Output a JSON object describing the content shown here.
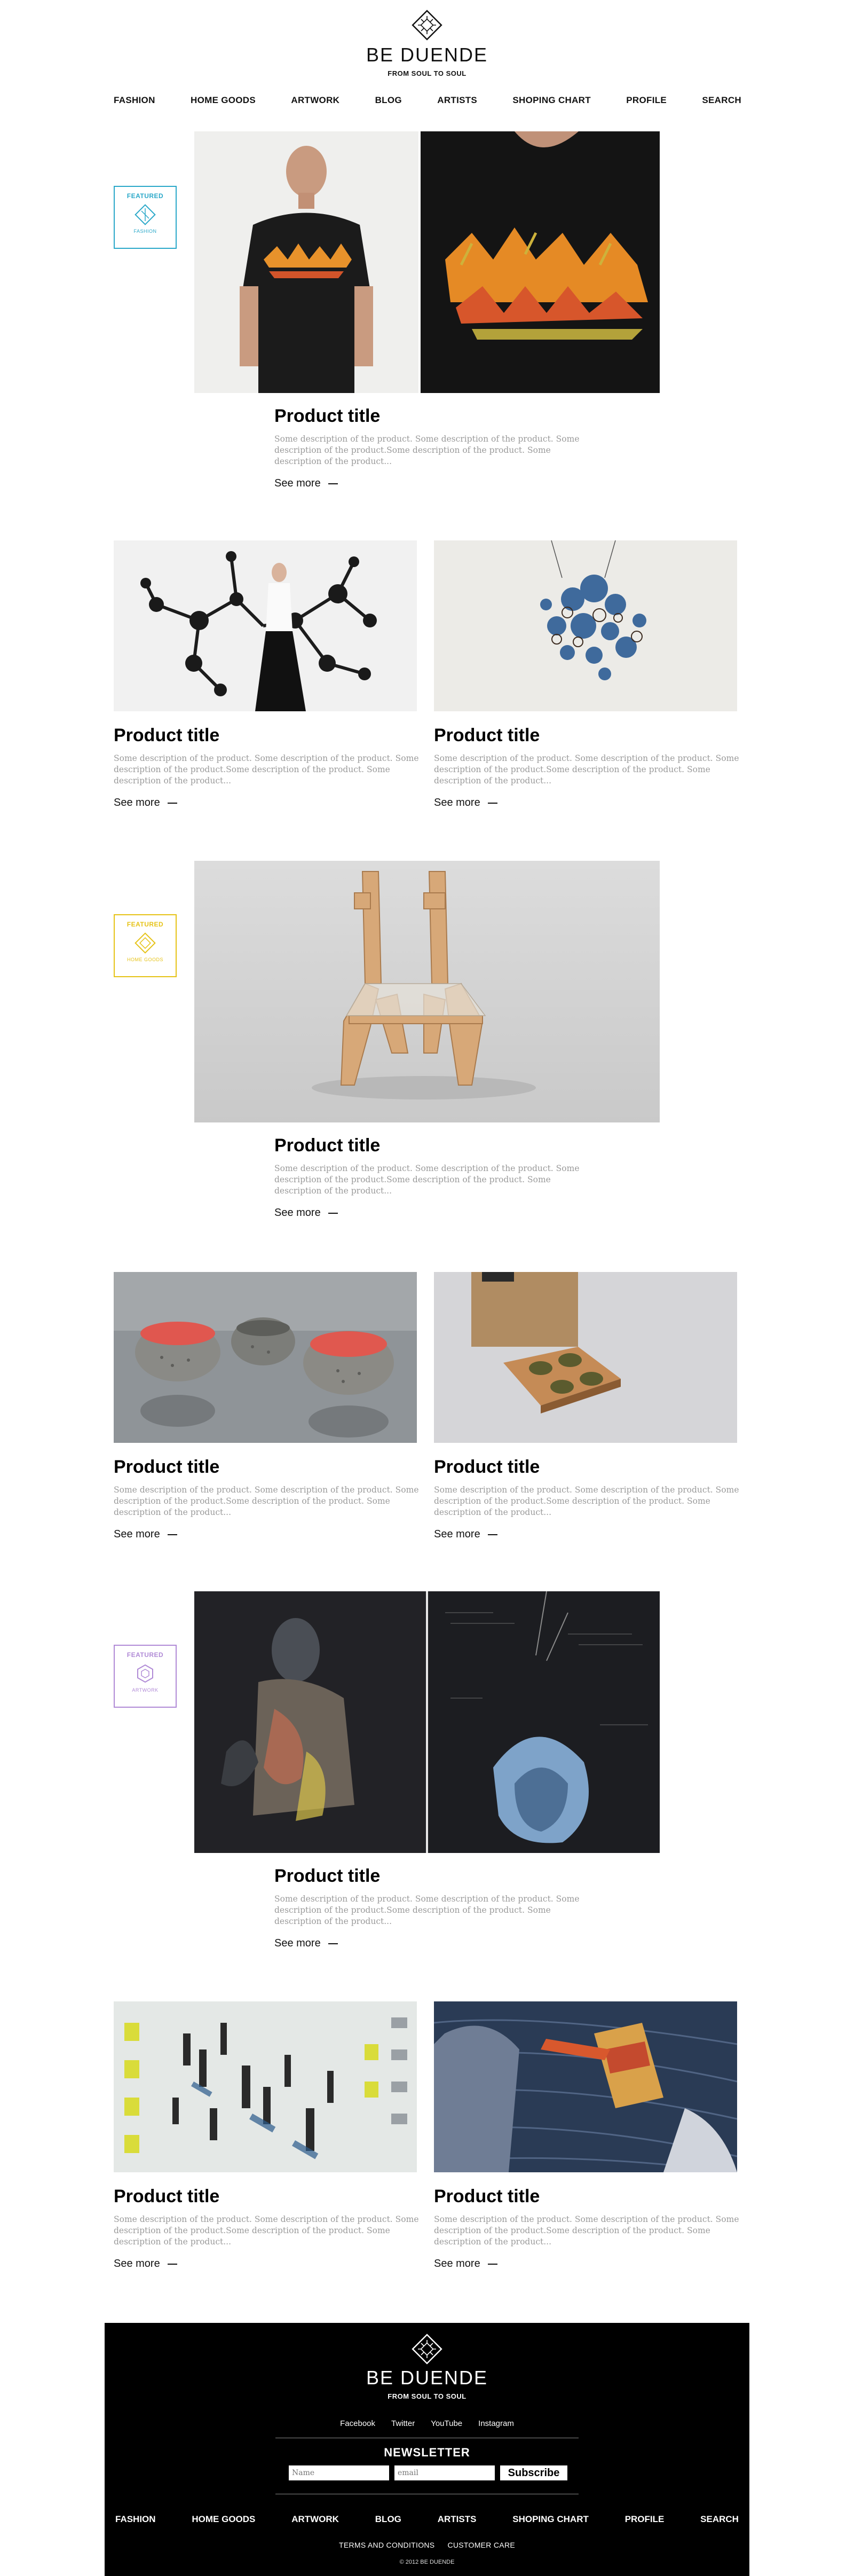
{
  "brand": {
    "name": "BE DUENDE",
    "tagline": "FROM SOUL TO SOUL"
  },
  "nav": [
    "FASHION",
    "HOME GOODS",
    "ARTWORK",
    "BLOG",
    "ARTISTS",
    "SHOPING CHART",
    "PROFILE",
    "SEARCH"
  ],
  "featured_badges": [
    {
      "top": "FEATURED",
      "bottom": "FASHION",
      "color": "#2aa8c9"
    },
    {
      "top": "FEATURED",
      "bottom": "HOME GOODS",
      "color": "#e6c317"
    },
    {
      "top": "FEATURED",
      "bottom": "ARTWORK",
      "color": "#b08ad6"
    }
  ],
  "products": [
    {
      "title": "Product title",
      "desc": "Some description of the product. Some description of the product. Some description of the product.Some description of the product. Some description of the product...",
      "more": "See more"
    },
    {
      "title": "Product title",
      "desc": "Some description of the product. Some description of the product. Some description of the product.Some description of the product. Some description of the product...",
      "more": "See more"
    },
    {
      "title": "Product title",
      "desc": "Some description of the product. Some description of the product. Some description of the product.Some description of the product. Some description of the product...",
      "more": "See more"
    },
    {
      "title": "Product title",
      "desc": "Some description of the product. Some description of the product. Some description of the product.Some description of the product. Some description of the product...",
      "more": "See more"
    },
    {
      "title": "Product title",
      "desc": "Some description of the product. Some description of the product. Some description of the product.Some description of the product. Some description of the product...",
      "more": "See more"
    },
    {
      "title": "Product title",
      "desc": "Some description of the product. Some description of the product. Some description of the product.Some description of the product. Some description of the product...",
      "more": "See more"
    },
    {
      "title": "Product title",
      "desc": "Some description of the product. Some description of the product. Some description of the product.Some description of the product. Some description of the product...",
      "more": "See more"
    },
    {
      "title": "Product title",
      "desc": "Some description of the product. Some description of the product. Some description of the product.Some description of the product. Some description of the product...",
      "more": "See more"
    },
    {
      "title": "Product title",
      "desc": "Some description of the product. Some description of the product. Some description of the product.Some description of the product. Some description of the product...",
      "more": "See more"
    }
  ],
  "footer": {
    "social": [
      "Facebook",
      "Twitter",
      "YouTube",
      "Instagram"
    ],
    "newsletter": "NEWSLETTER",
    "name_placeholder": "Name",
    "email_placeholder": "email",
    "subscribe": "Subscribe",
    "nav": [
      "FASHION",
      "HOME GOODS",
      "ARTWORK",
      "BLOG",
      "ARTISTS",
      "SHOPING CHART",
      "PROFILE",
      "SEARCH"
    ],
    "legal": [
      "TERMS AND CONDITIONS",
      "CUSTOMER CARE"
    ],
    "copyright": "© 2012 BE DUENDE"
  },
  "colors": {
    "fashion": "#2aa8c9",
    "home_goods": "#e6c317",
    "artwork": "#b08ad6",
    "desc_text": "#9a9a9a"
  }
}
